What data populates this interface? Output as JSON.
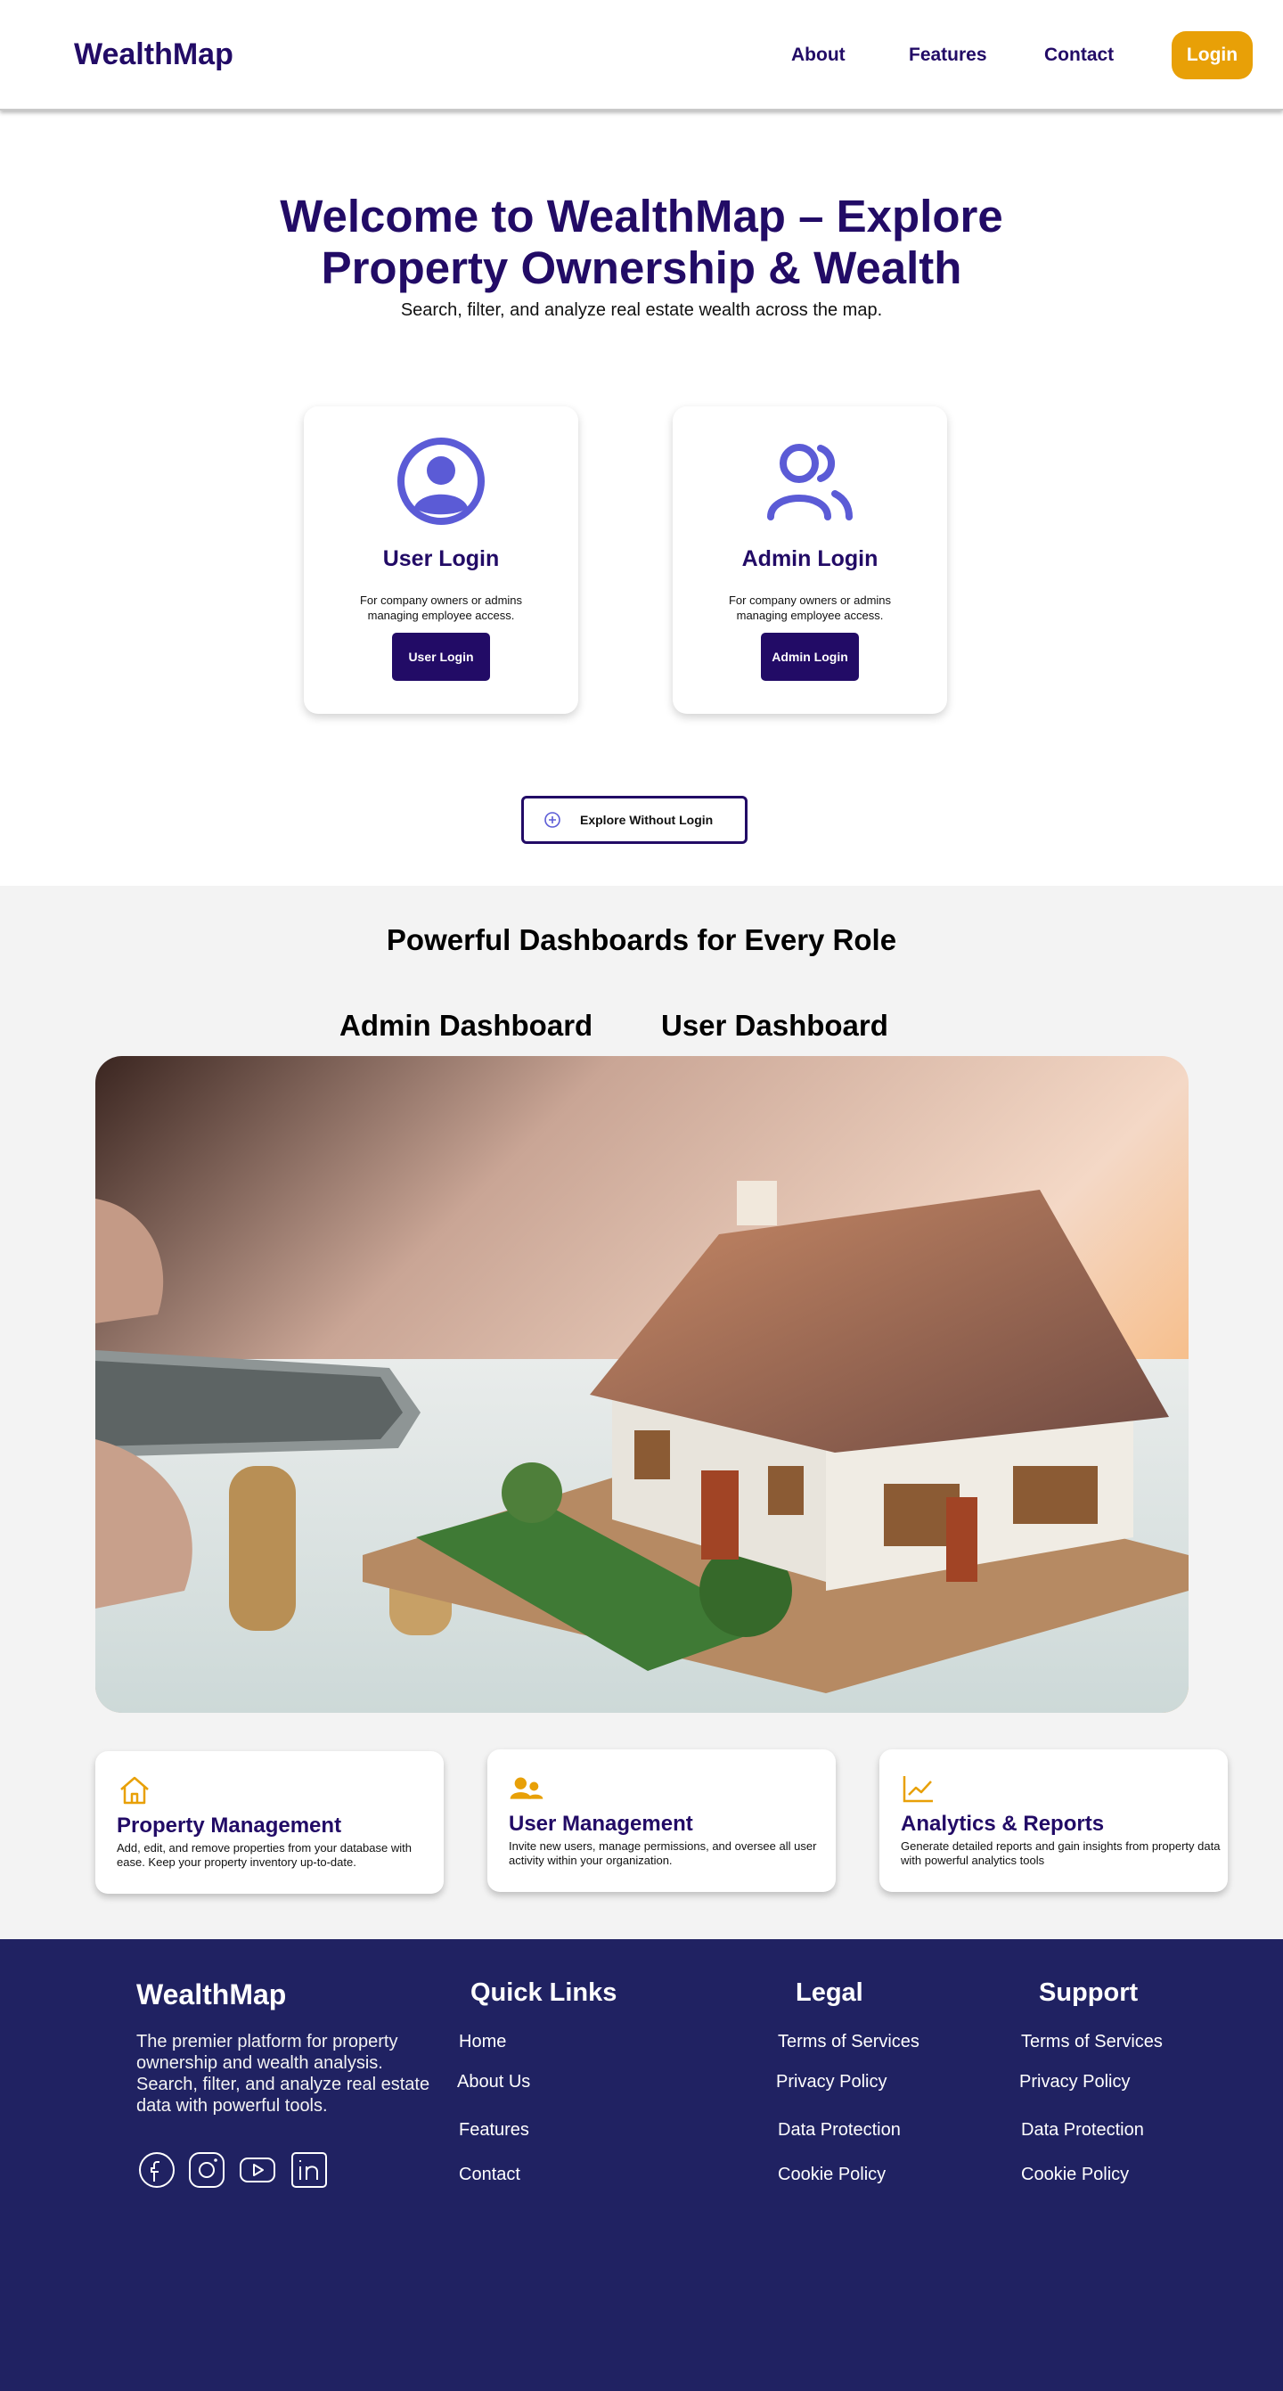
{
  "header": {
    "logo": "WealthMap",
    "nav": {
      "about": "About",
      "features": "Features",
      "contact": "Contact"
    },
    "login_label": "Login"
  },
  "hero": {
    "title": "Welcome to WealthMap – Explore Property Ownership & Wealth",
    "subtitle": "Search, filter, and analyze real estate wealth across the map."
  },
  "login_cards": {
    "user": {
      "title": "User Login",
      "description": "For company owners or admins managing employee access.",
      "button": "User Login",
      "icon": "user-circle-icon"
    },
    "admin": {
      "title": "Admin Login",
      "description": "For company owners or admins managing employee access.",
      "button": "Admin Login",
      "icon": "users-icon"
    }
  },
  "explore": {
    "label": "Explore Without Login",
    "icon": "plus-circle-icon"
  },
  "dashboards": {
    "heading": "Powerful Dashboards for Every Role",
    "tabs": [
      "Admin Dashboard",
      "User Dashboard"
    ],
    "image": "house-model-with-coins-photo"
  },
  "features": [
    {
      "title": "Property Management",
      "description": "Add, edit, and remove properties from your database with ease. Keep your property inventory up-to-date.",
      "icon": "home-icon"
    },
    {
      "title": "User Management",
      "description": "Invite new users, manage permissions, and oversee all user activity within your organization.",
      "icon": "users-icon"
    },
    {
      "title": "Analytics & Reports",
      "description": "Generate detailed reports and gain insights from property data with powerful analytics tools",
      "icon": "chart-line-icon"
    }
  ],
  "footer": {
    "brand": "WealthMap",
    "about": "The premier platform for property ownership and wealth analysis. Search, filter, and analyze real estate data with powerful tools.",
    "social": [
      "facebook-icon",
      "instagram-icon",
      "youtube-icon",
      "linkedin-icon"
    ],
    "quick_links": {
      "heading": "Quick Links",
      "items": [
        "Home",
        "About Us",
        "Features",
        "Contact"
      ]
    },
    "legal": {
      "heading": "Legal",
      "items": [
        "Terms of Services",
        "Privacy Policy",
        "Data Protection",
        "Cookie Policy"
      ]
    },
    "support": {
      "heading": "Support",
      "items": [
        "Terms of Services",
        "Privacy Policy",
        "Data Protection",
        "Cookie Policy"
      ]
    }
  },
  "colors": {
    "brand": "#220b66",
    "accent": "#e8a007",
    "icon_blue": "#5b5bd6",
    "footer_bg": "#202262",
    "section_bg": "#f3f3f3"
  }
}
